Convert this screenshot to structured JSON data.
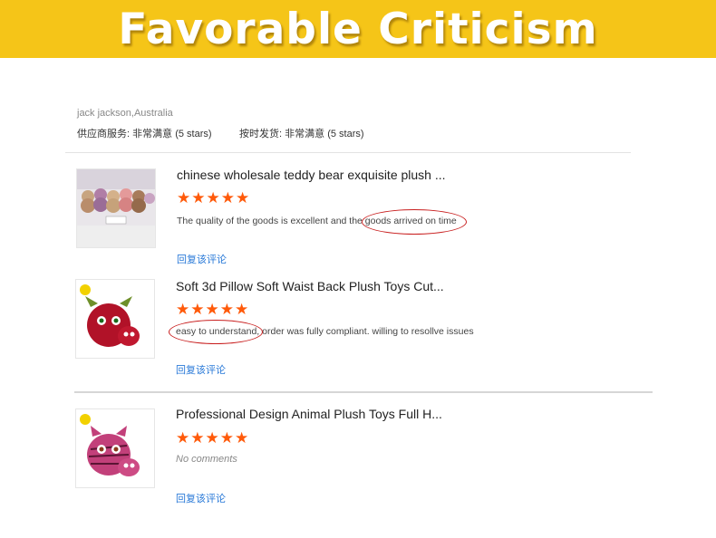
{
  "banner": {
    "title": "Favorable Criticism",
    "bg_color": "#f5c518"
  },
  "reviewer": {
    "name_location": "jack jackson,Australia",
    "supplier_service_label": "供应商服务:",
    "supplier_service_value": "非常满意",
    "supplier_service_stars": "(5 stars)",
    "shipping_label": "按时发货:",
    "shipping_value": "非常满意",
    "shipping_stars": "(5 stars)"
  },
  "reviews": [
    {
      "title": "chinese wholesale teddy bear exquisite plush ...",
      "stars": "★★★★★",
      "rating": 5,
      "comment": "The quality of the goods is excellent and the goods arrived on time",
      "reply_label": "回复该评论",
      "thumb_icon": "teddy-bears-photo"
    },
    {
      "title": "Soft 3d Pillow Soft Waist Back Plush Toys Cut...",
      "stars": "★★★★★",
      "rating": 5,
      "comment": "easy to understand, order was fully compliant. willing to resollve issues",
      "reply_label": "回复该评论",
      "thumb_icon": "red-plush-owl-photo"
    },
    {
      "title": "Professional Design Animal Plush Toys Full H...",
      "stars": "★★★★★",
      "rating": 5,
      "comment": "No comments",
      "reply_label": "回复该评论",
      "thumb_icon": "pink-zebra-plush-photo"
    }
  ],
  "colors": {
    "star": "#ff5a0a",
    "link": "#2a7ad8",
    "highlight_circle": "#c81e1e"
  }
}
